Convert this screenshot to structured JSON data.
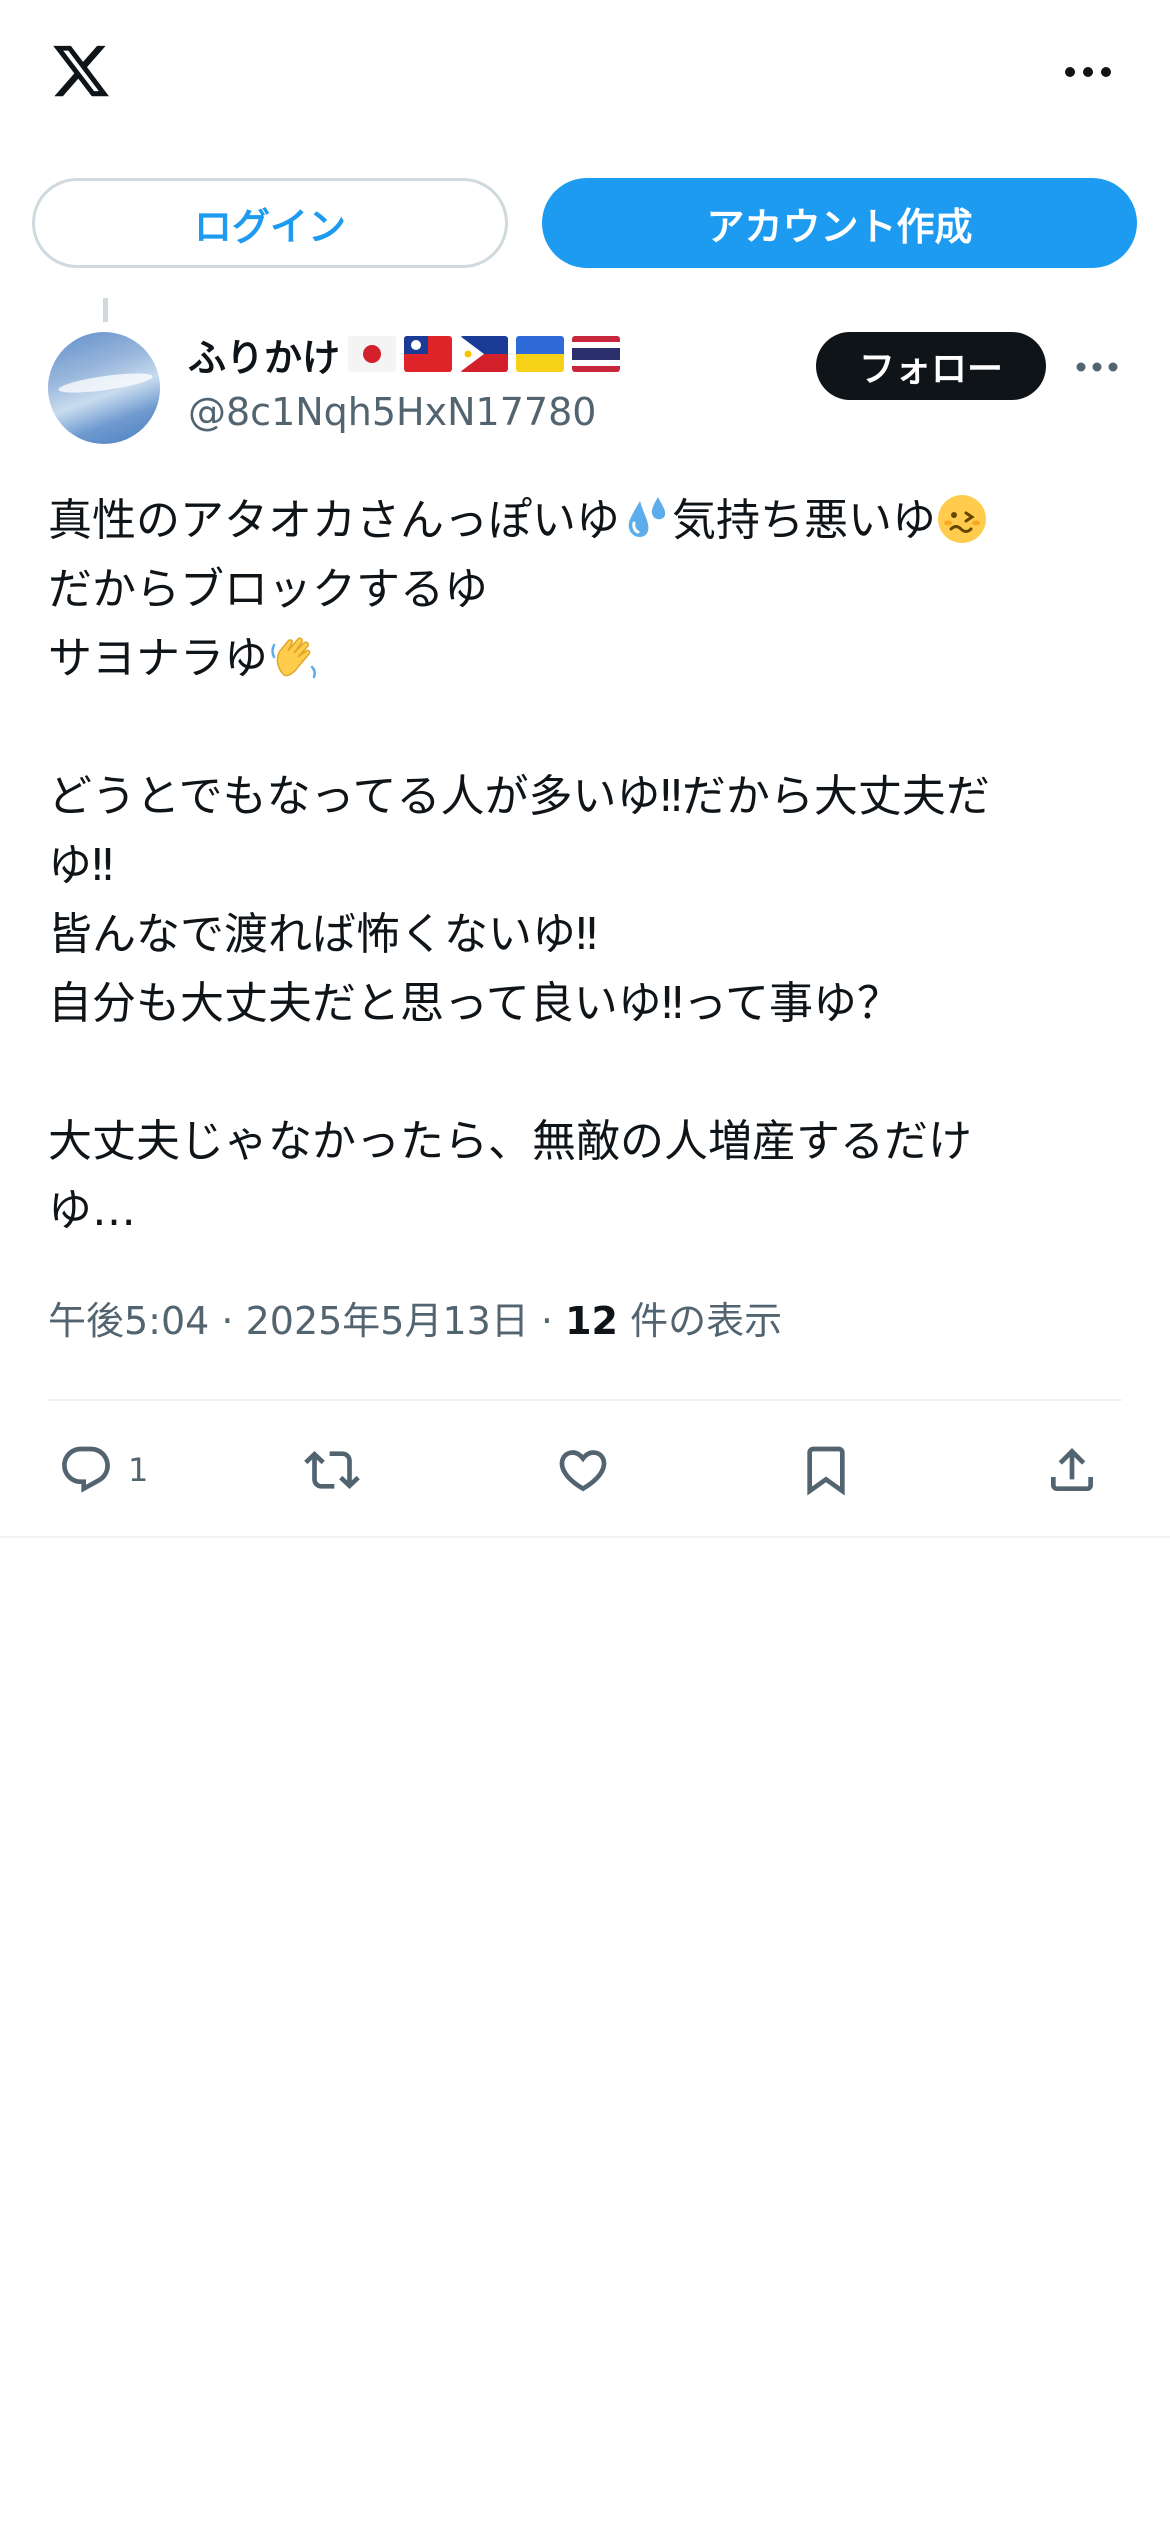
{
  "header": {
    "logo_icon": "x-logo-icon",
    "more_icon": "more-horizontal-icon"
  },
  "auth": {
    "login_label": "ログイン",
    "signup_label": "アカウント作成"
  },
  "colors": {
    "accent": "#1d9bf0",
    "text_primary": "#0f1419",
    "text_secondary": "#536471",
    "border": "#cfd9de"
  },
  "tweet": {
    "author": {
      "display_name": "ふりかけ",
      "flags": [
        "japan-flag-icon",
        "taiwan-flag-icon",
        "philippines-flag-icon",
        "ukraine-flag-icon",
        "thailand-flag-icon"
      ],
      "handle": "@8c1Nqh5HxN17780"
    },
    "follow_label": "フォロー",
    "text": {
      "line1": "真性のアタオカさんっぽいゆ",
      "line1b": "気持ち悪いゆ",
      "line2": "だからブロックするゆ",
      "line3": "サヨナラゆ",
      "line4": "どうとでもなってる人が多いゆ‼だから大丈夫だ",
      "line5": "ゆ‼",
      "line6": "皆んなで渡れば怖くないゆ‼",
      "line7": "自分も大丈夫だと思って良いゆ‼って事ゆ？",
      "line8": "大丈夫じゃなかったら、無敵の人増産するだけ",
      "line9": "ゆ…"
    },
    "emojis": [
      "sweat-droplets-icon",
      "woozy-face-icon",
      "waving-hand-icon"
    ],
    "meta": {
      "time": "午後5:04",
      "date": "2025年5月13日",
      "views_count": "12",
      "views_label": "件の表示"
    },
    "actions": {
      "reply_count": "1"
    }
  }
}
